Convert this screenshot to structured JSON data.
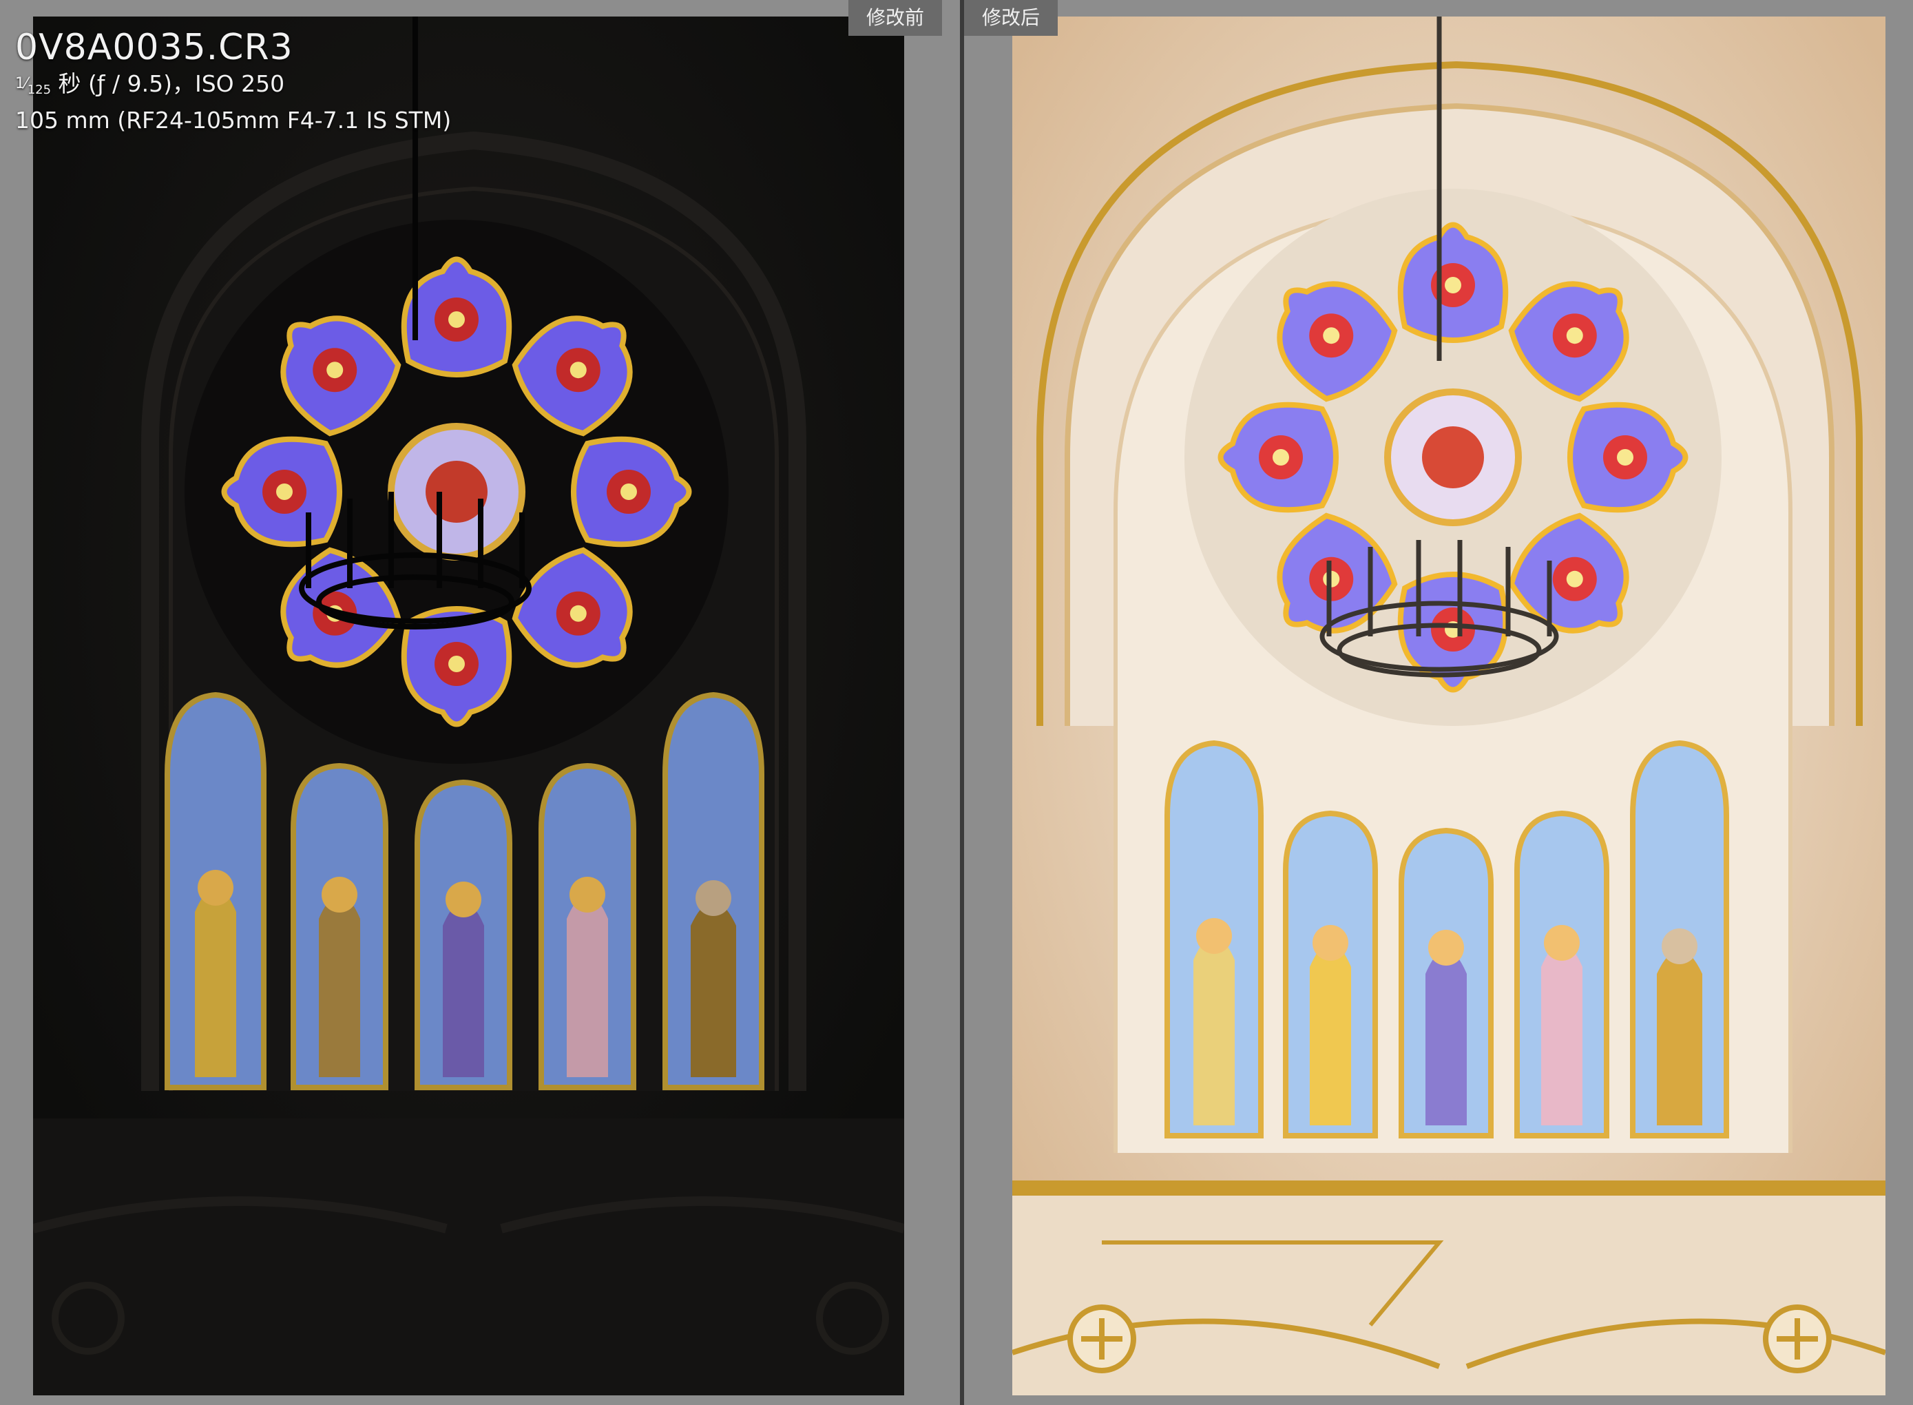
{
  "file_info": {
    "filename": "0V8A0035.CR3",
    "shutter_numerator": "1",
    "shutter_denominator": "125",
    "exposure_rest": " 秒 (ƒ / 9.5)，ISO 250",
    "lens_line": "105 mm (RF24-105mm F4-7.1 IS STM)"
  },
  "compare": {
    "before_label": "修改前",
    "after_label": "修改后"
  },
  "colors": {
    "background": "#8d8d8d",
    "before_wall": "#141312",
    "after_wall": "#efe2d2",
    "gold_trim": "#c99a2e"
  }
}
